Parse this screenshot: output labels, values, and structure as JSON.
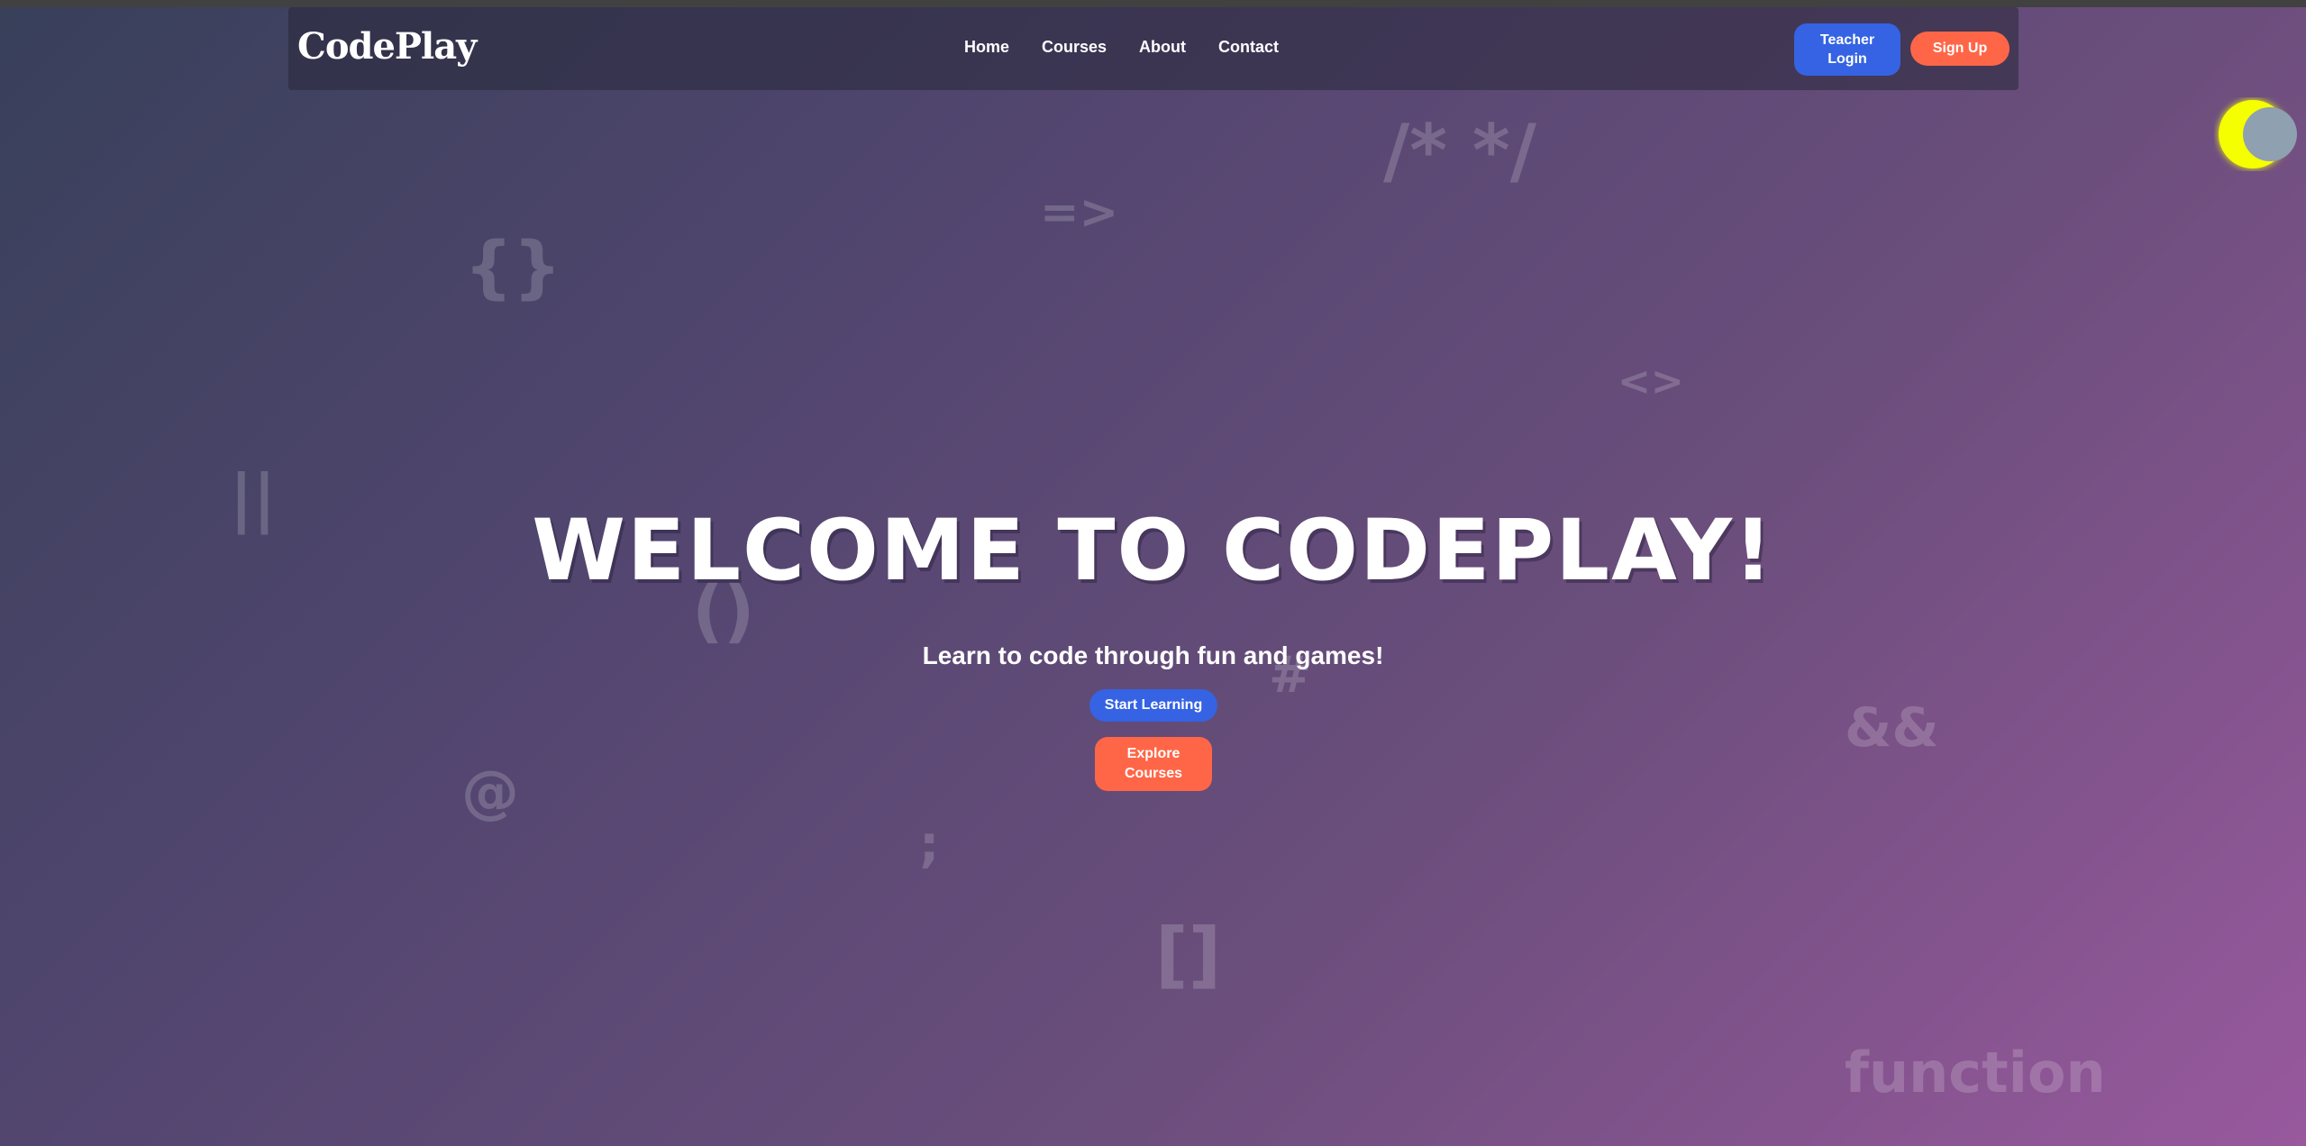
{
  "header": {
    "logo": "CodePlay",
    "nav": [
      "Home",
      "Courses",
      "About",
      "Contact"
    ],
    "teacher_login_line1": "Teacher",
    "teacher_login_line2": "Login",
    "sign_up": "Sign Up"
  },
  "theme_toggle": {
    "icon": "moon-icon",
    "colors": {
      "moon": "#f5ff00",
      "shade": "#8fa0b0"
    }
  },
  "background_symbols": [
    "/* */",
    "=>",
    "{}",
    "<>",
    "||",
    "()",
    "#",
    "&&",
    "@",
    ";",
    "[]",
    "function"
  ],
  "hero": {
    "title": "WELCOME TO CODEPLAY!",
    "subtitle": "Learn to code through fun and games!",
    "start_button": "Start Learning",
    "explore_line1": "Explore",
    "explore_line2": "Courses"
  },
  "colors": {
    "primary_blue": "#3563e3",
    "accent_orange": "#ff6647",
    "gradient_start": "#38405a",
    "gradient_end": "#98599d"
  }
}
